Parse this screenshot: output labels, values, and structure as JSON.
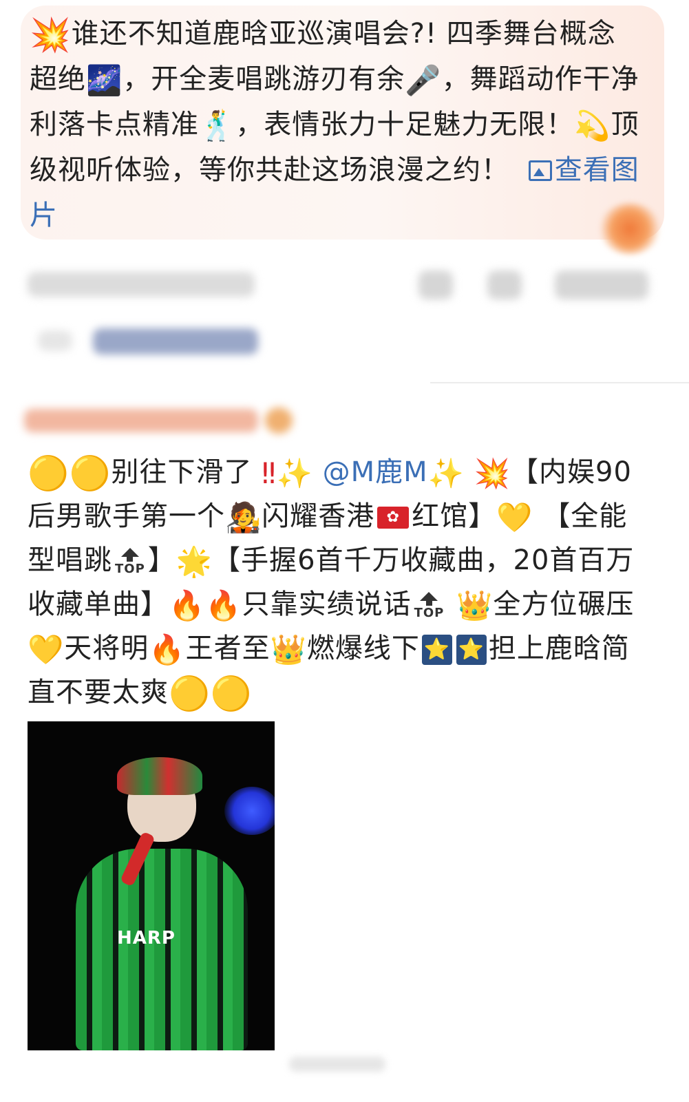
{
  "ad_post": {
    "text_lines": [
      "谁还不知道鹿晗亚巡演唱会?!",
      "四季舞台概念超绝",
      "，开全麦唱跳游刃有余",
      "，舞蹈动作干净利落卡点精准",
      "，表情张力十足魅力无限！",
      "顶级视听体验，等你共赴这场浪漫之约！"
    ],
    "view_image_label": "查看图片"
  },
  "comment": {
    "segments": [
      "别往下滑了",
      "@M鹿M",
      "【内娱90后男歌手第一个",
      "闪耀香港",
      "红馆】",
      "【全能型唱跳",
      "】",
      "【手握6首千万收藏曲，20首百万收藏单曲】",
      "只靠实绩说话",
      "全方位碾压",
      "天将明",
      "王者至",
      "燃爆线下",
      "担上鹿晗简直不要太爽"
    ],
    "top_label": "TOP",
    "figure_shirt_text": "HARP"
  },
  "icons": [
    "collision-icon",
    "sparkles-icon",
    "microphone-icon",
    "dancer-icon",
    "shooting-star-icon",
    "yellow-circle-icon",
    "double-exclamation-icon",
    "singer-icon",
    "hk-flag-icon",
    "yellow-heart-icon",
    "top-arrow-icon",
    "glowing-star-icon",
    "fire-icon",
    "crown-icon",
    "star-box-icon",
    "image-icon",
    "night-sky-icon"
  ],
  "colors": {
    "link_blue": "#3b6fb6",
    "text_dark": "#222222",
    "ad_background": "#fdf3ef"
  }
}
